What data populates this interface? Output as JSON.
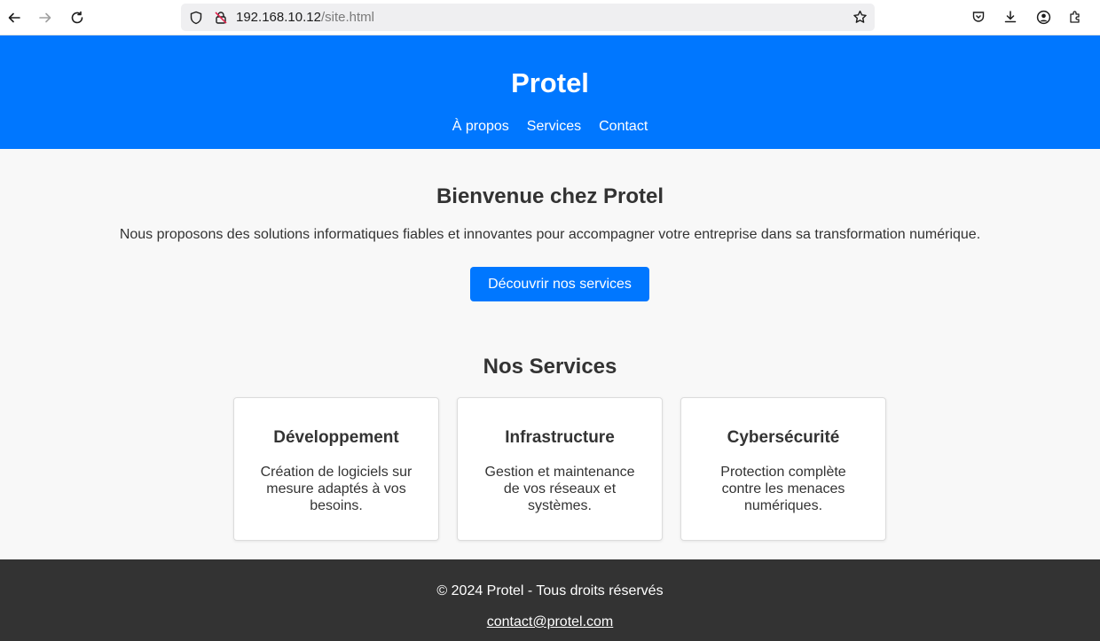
{
  "browser": {
    "url_host": "192.168.10.12",
    "url_path": "/site.html",
    "icons": [
      "back-icon",
      "forward-icon",
      "reload-icon",
      "shield-icon",
      "insecure-lock-icon",
      "bookmark-star-icon",
      "pocket-icon",
      "download-icon",
      "account-icon",
      "extensions-icon"
    ]
  },
  "header": {
    "title": "Protel",
    "nav": [
      "À propos",
      "Services",
      "Contact"
    ]
  },
  "hero": {
    "title": "Bienvenue chez Protel",
    "text": "Nous proposons des solutions informatiques fiables et innovantes pour accompagner votre entreprise dans sa transformation numérique.",
    "button": "Découvrir nos services"
  },
  "services": {
    "title": "Nos Services",
    "cards": [
      {
        "title": "Développement",
        "text": "Création de logiciels sur mesure adaptés à vos besoins."
      },
      {
        "title": "Infrastructure",
        "text": "Gestion et maintenance de vos réseaux et systèmes."
      },
      {
        "title": "Cybersécurité",
        "text": "Protection complète contre les menaces numériques."
      }
    ]
  },
  "footer": {
    "copyright": "© 2024 Protel - Tous droits réservés",
    "email": "contact@protel.com"
  },
  "colors": {
    "brand_blue": "#0077ff",
    "footer_bg": "#333333",
    "page_bg": "#f8f8f8"
  }
}
